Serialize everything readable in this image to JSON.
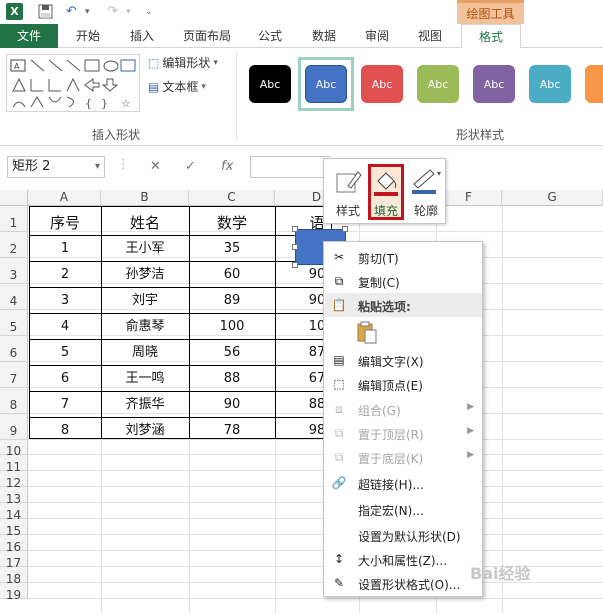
{
  "titlebar": {
    "app_icon": "X",
    "draw_tools_label": "绘图工具"
  },
  "tabs": [
    {
      "label": "文件"
    },
    {
      "label": "开始"
    },
    {
      "label": "插入"
    },
    {
      "label": "页面布局"
    },
    {
      "label": "公式"
    },
    {
      "label": "数据"
    },
    {
      "label": "审阅"
    },
    {
      "label": "视图"
    },
    {
      "label": "格式"
    }
  ],
  "ribbon": {
    "edit_shape": "编辑形状",
    "text_box": "文本框",
    "insert_shapes_group": "插入形状",
    "shape_styles_group": "形状样式",
    "style_swatch_label": "Abc",
    "style_colors": [
      "#000000",
      "#4472c4",
      "#e05050",
      "#9bbb59",
      "#8064a2",
      "#4bacc6",
      "#f79646"
    ]
  },
  "formulabar": {
    "namebox": "矩形 2",
    "fx": "fx"
  },
  "columns": [
    "A",
    "B",
    "C",
    "D",
    "E",
    "F",
    "G"
  ],
  "rows": [
    "1",
    "2",
    "3",
    "4",
    "5",
    "6",
    "7",
    "8",
    "9",
    "10",
    "11",
    "12",
    "13",
    "14",
    "15",
    "16",
    "17",
    "18",
    "19"
  ],
  "table": {
    "headers": [
      "序号",
      "姓名",
      "数学",
      "语"
    ],
    "rows": [
      [
        "1",
        "王小军",
        "35",
        ""
      ],
      [
        "2",
        "孙梦洁",
        "60",
        "90"
      ],
      [
        "3",
        "刘宇",
        "89",
        "90"
      ],
      [
        "4",
        "俞惠琴",
        "100",
        "10"
      ],
      [
        "5",
        "周晓",
        "56",
        "87"
      ],
      [
        "6",
        "王一鸣",
        "88",
        "67"
      ],
      [
        "7",
        "齐振华",
        "90",
        "88"
      ],
      [
        "8",
        "刘梦涵",
        "78",
        "98"
      ]
    ]
  },
  "minibar": {
    "style": "样式",
    "fill": "填充",
    "outline": "轮廓"
  },
  "context_menu": {
    "cut": "剪切(T)",
    "copy": "复制(C)",
    "paste_options": "粘贴选项:",
    "edit_text": "编辑文字(X)",
    "edit_points": "编辑顶点(E)",
    "group": "组合(G)",
    "bring_front": "置于顶层(R)",
    "send_back": "置于底层(K)",
    "hyperlink": "超链接(H)...",
    "assign_macro": "指定宏(N)...",
    "set_default": "设置为默认形状(D)",
    "size_props": "大小和属性(Z)...",
    "format_shape": "设置形状格式(O)..."
  },
  "watermark": "Bai经验"
}
